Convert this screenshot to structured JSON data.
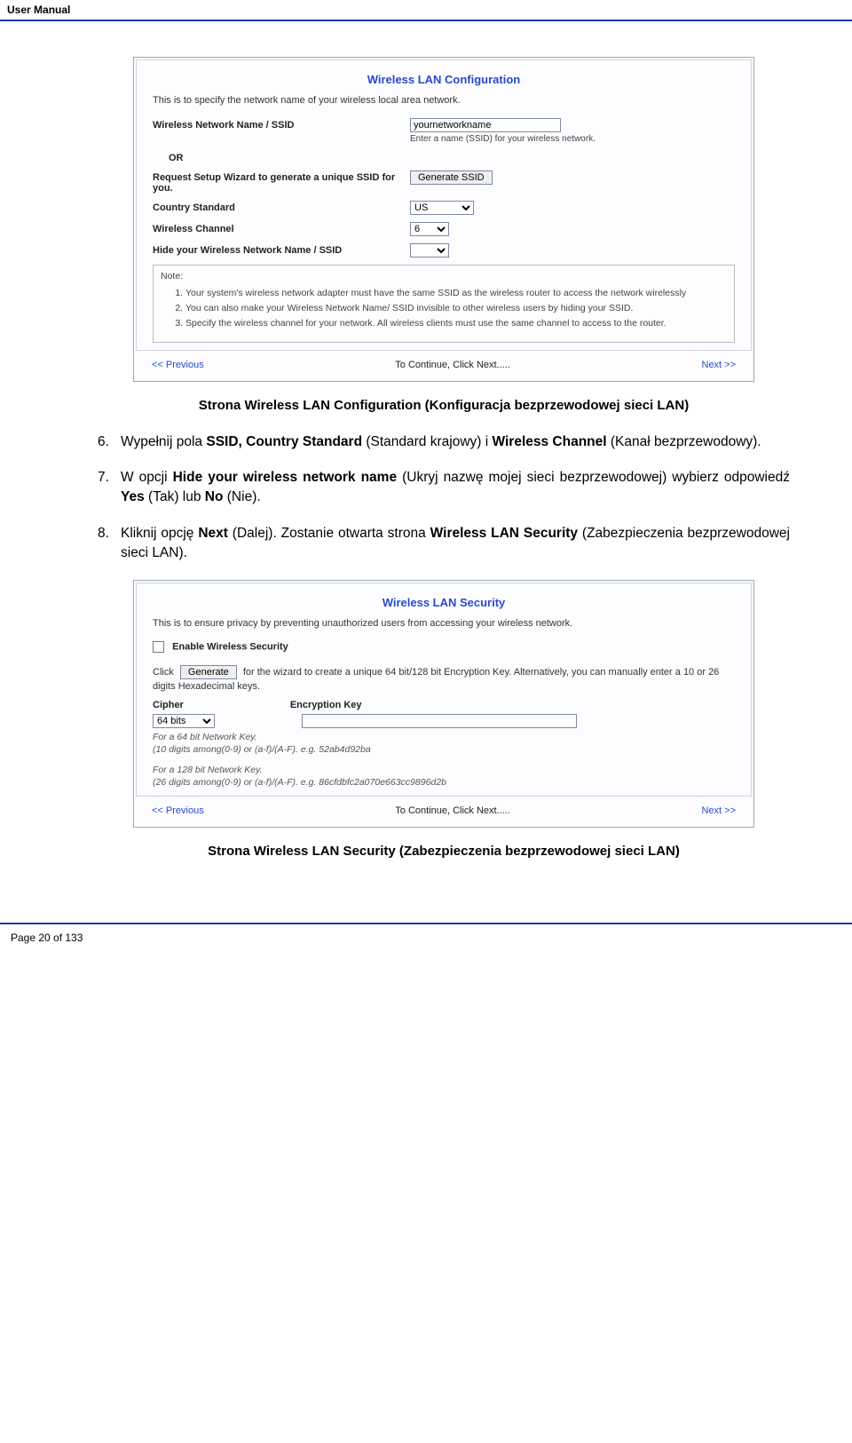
{
  "header": {
    "title": "User Manual"
  },
  "panel1": {
    "heading": "Wireless LAN Configuration",
    "description": "This is to specify the network name of your wireless local area network.",
    "ssid": {
      "label": "Wireless Network Name / SSID",
      "value": "yournetworkname",
      "hint": "Enter a name (SSID) for your wireless network."
    },
    "or": "OR",
    "request_wizard_label": "Request Setup Wizard to generate a unique SSID for you.",
    "generate_btn": "Generate SSID",
    "country": {
      "label": "Country Standard",
      "value": "US"
    },
    "channel": {
      "label": "Wireless Channel",
      "value": "6"
    },
    "hide_ssid": {
      "label": "Hide your Wireless Network Name / SSID",
      "value": ""
    },
    "note_title": "Note:",
    "notes": [
      "Your system's wireless network adapter must have the same SSID as the wireless router to access the network wirelessly",
      "You can also make your Wireless Network Name/ SSID invisible to other wireless users by hiding your SSID.",
      "Specify the wireless channel for your network. All wireless clients must use the same channel to access to the router."
    ],
    "footer": {
      "prev": "<< Previous",
      "cont": "To Continue, Click Next.....",
      "next": "Next >>"
    }
  },
  "caption1": "Strona Wireless LAN Configuration (Konfiguracja bezprzewodowej sieci LAN)",
  "instructions": {
    "i6_num": "6.",
    "i6a": "Wypełnij pola ",
    "i6b": "SSID, Country Standard",
    "i6c": " (Standard krajowy) i ",
    "i6d": "Wireless Channel",
    "i6e": " (Kanał bezprzewodowy).",
    "i7_num": "7.",
    "i7a": "W opcji ",
    "i7b": "Hide your wireless network name",
    "i7c": " (Ukryj nazwę mojej sieci bezprzewodowej) wybierz odpowiedź ",
    "i7d": "Yes",
    "i7e": " (Tak) lub ",
    "i7f": "No",
    "i7g": " (Nie).",
    "i8_num": "8.",
    "i8a": "Kliknij opcję ",
    "i8b": "Next",
    "i8c": " (Dalej). Zostanie otwarta strona ",
    "i8d": "Wireless LAN Security",
    "i8e": " (Zabezpieczenia bezprzewodowej sieci LAN)."
  },
  "panel2": {
    "heading": "Wireless LAN Security",
    "description": "This is to ensure privacy by preventing unauthorized users from accessing your wireless network.",
    "enable_label": "Enable Wireless Security",
    "click_text_a": "Click",
    "generate_btn": "Generate",
    "click_text_b": "for the wizard to create a unique 64 bit/128 bit Encryption Key. Alternatively, you can manually enter a 10 or 26 digits Hexadecimal keys.",
    "cipher_label": "Cipher",
    "enckey_label": "Encryption Key",
    "cipher_value": "64 bits",
    "enckey_value": "",
    "hint64a": "For a 64 bit Network Key.",
    "hint64b": "(10 digits among(0-9) or (a-f)/(A-F). e.g. 52ab4d92ba",
    "hint128a": "For a 128 bit Network Key.",
    "hint128b": "(26 digits among(0-9) or (a-f)/(A-F). e.g. 86cfdbfc2a070e663cc9896d2b",
    "footer": {
      "prev": "<< Previous",
      "cont": "To Continue, Click Next.....",
      "next": "Next >>"
    }
  },
  "caption2": "Strona Wireless LAN Security (Zabezpieczenia bezprzewodowej sieci LAN)",
  "footer": {
    "page": "Page 20 of 133"
  }
}
